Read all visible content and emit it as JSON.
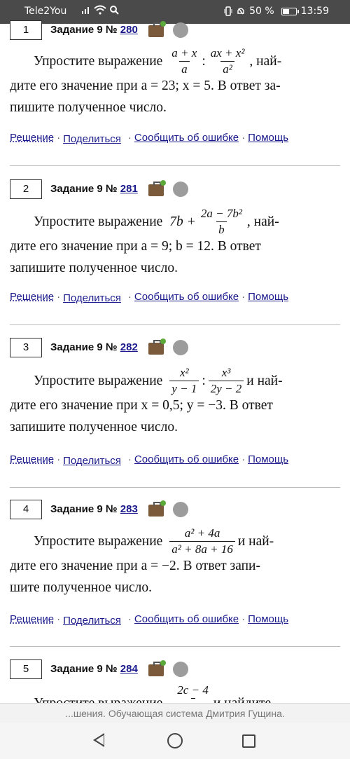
{
  "status": {
    "carrier": "Tele2You",
    "battery": "50 %",
    "battery_level": 0.5,
    "time": "13:59",
    "icons": [
      "signal-icon",
      "wifi-icon",
      "search-icon",
      "vibrate-icon",
      "bell-icon",
      "battery-icon"
    ]
  },
  "problems": [
    {
      "num": "1",
      "title": "Задание 9 №",
      "id": "280",
      "intro": "Упростите выражение",
      "after_expr": ", най-",
      "line2": "дите его значение при a = 23; x = 5. В ответ за-",
      "line3": "пишите полученное число."
    },
    {
      "num": "2",
      "title": "Задание 9 №",
      "id": "281",
      "intro": "Упростите выражение",
      "after_expr": ", най-",
      "line2": "дите его значение при a = 9; b = 12. В ответ",
      "line3": "запишите полученное число."
    },
    {
      "num": "3",
      "title": "Задание 9 №",
      "id": "282",
      "intro": "Упростите выражение",
      "after_expr": " и най-",
      "line2": "дите его значение при x = 0,5; y = −3. В ответ",
      "line3": "запишите полученное число."
    },
    {
      "num": "4",
      "title": "Задание 9 №",
      "id": "283",
      "intro": "Упростите выражение",
      "after_expr": " и най-",
      "line2": "дите его значение при a = −2. В ответ запи-",
      "line3": "шите полученное число."
    },
    {
      "num": "5",
      "title": "Задание 9 №",
      "id": "284",
      "intro": "Упростите выражение",
      "after_expr": " и найдите",
      "line2": "",
      "line3": ""
    }
  ],
  "expressions": {
    "p1": {
      "f1_num": "a + x",
      "f1_den": "a",
      "op": ":",
      "f2_num": "ax + x²",
      "f2_den": "a²"
    },
    "p2": {
      "pre": "7b +",
      "f1_num": "2a − 7b²",
      "f1_den": "b"
    },
    "p3": {
      "f1_num": "x²",
      "f1_den": "y − 1",
      "op": ":",
      "f2_num": "x³",
      "f2_den": "2y − 2"
    },
    "p4": {
      "f1_num": "a² + 4a",
      "f1_den": "a² + 8a + 16"
    },
    "p5": {
      "f1_num": "2c − 4",
      "f1_den": ""
    }
  },
  "links": {
    "solution": "Решение",
    "share": "Поделиться",
    "report": "Сообщить об ошибке",
    "help": "Помощь",
    "sep": "·"
  },
  "footer": "...шения. Обучающая система Дмитрия Гущина.",
  "nav": [
    "back-icon",
    "home-icon",
    "recents-icon"
  ]
}
